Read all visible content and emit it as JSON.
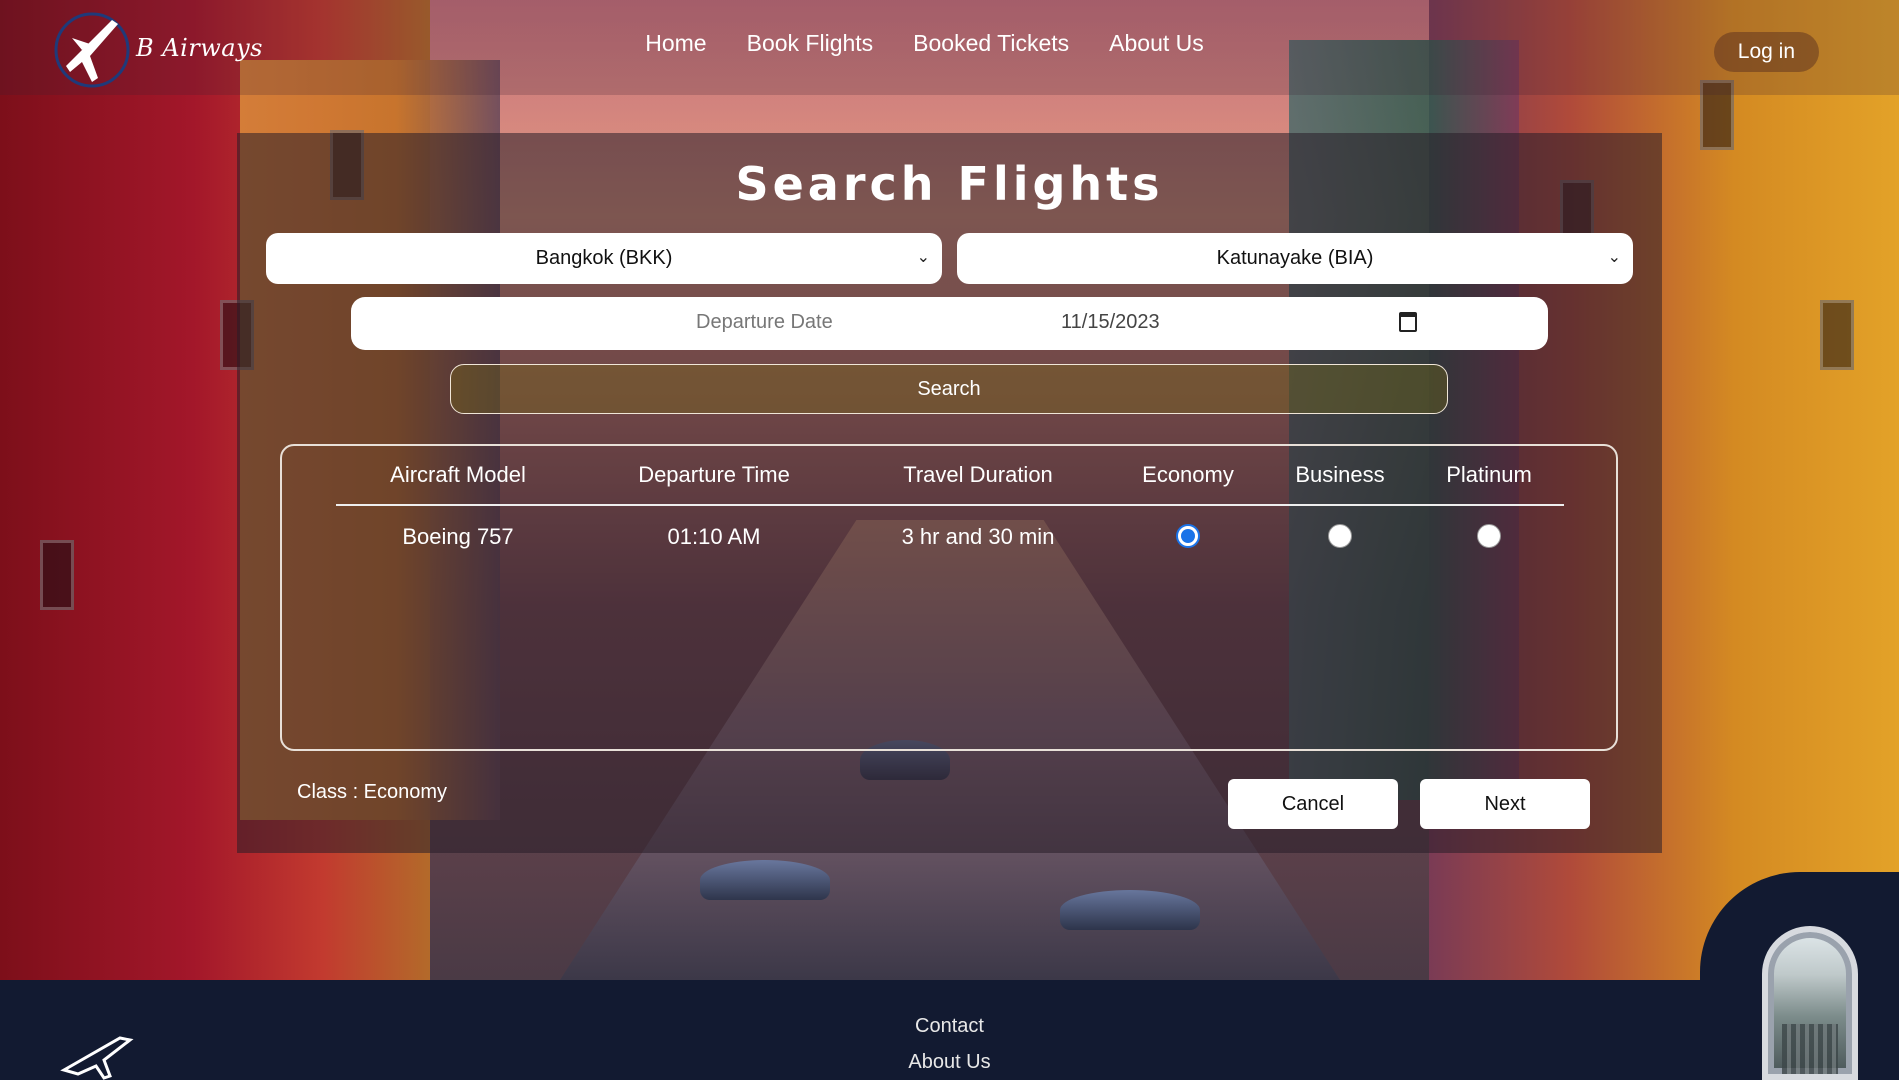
{
  "header": {
    "brand": "B Airways",
    "nav": [
      "Home",
      "Book Flights",
      "Booked Tickets",
      "About Us"
    ],
    "login_label": "Log in"
  },
  "search": {
    "title": "Search Flights",
    "from_selected": "Bangkok (BKK)",
    "to_selected": "Katunayake (BIA)",
    "date_placeholder": "Departure Date",
    "date_value": "11/15/2023",
    "search_label": "Search"
  },
  "results": {
    "columns": [
      "Aircraft Model",
      "Departure Time",
      "Travel Duration",
      "Economy",
      "Business",
      "Platinum"
    ],
    "rows": [
      {
        "aircraft": "Boeing 757",
        "departure": "01:10 AM",
        "duration": "3 hr and 30 min",
        "selected_class": "Economy"
      }
    ]
  },
  "footer_actions": {
    "class_text": "Class : Economy",
    "cancel_label": "Cancel",
    "next_label": "Next"
  },
  "footer": {
    "links": [
      "Contact",
      "About Us"
    ]
  },
  "colors": {
    "radio_selected": "#1a73e8",
    "footer_bg": "#121a31",
    "panel_overlay": "rgba(40,30,40,0.55)"
  },
  "icons": {
    "logo": "plane-logo-icon",
    "select_chevron": "chevron-down-icon",
    "calendar": "calendar-icon",
    "footer_plane": "plane-icon",
    "porthole": "airplane-window-illustration"
  }
}
